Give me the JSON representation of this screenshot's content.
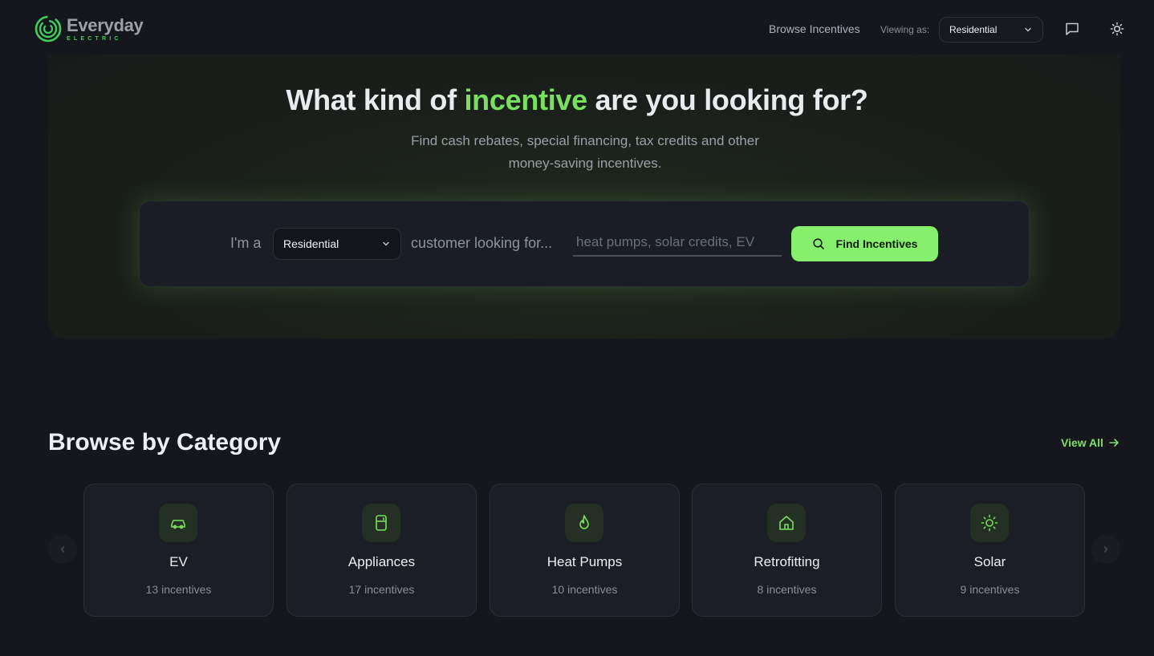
{
  "brand": {
    "name": "Everyday",
    "sub": "ELECTRIC"
  },
  "nav": {
    "browse_link": "Browse Incentives",
    "viewing_label": "Viewing as:",
    "viewing_value": "Residential"
  },
  "hero": {
    "title_before": "What kind of ",
    "title_accent": "incentive",
    "title_after": " are you looking for?",
    "subtitle": "Find cash rebates, special financing, tax credits and other money-saving incentives."
  },
  "search": {
    "prefix": "I'm a",
    "customer_type": "Residential",
    "middle": "customer looking for...",
    "placeholder": "heat pumps, solar credits, EV",
    "button_label": "Find Incentives"
  },
  "browse": {
    "title": "Browse by Category",
    "view_all": "View All",
    "categories": [
      {
        "name": "EV",
        "count": "13 incentives",
        "icon": "car-icon"
      },
      {
        "name": "Appliances",
        "count": "17 incentives",
        "icon": "fridge-icon"
      },
      {
        "name": "Heat Pumps",
        "count": "10 incentives",
        "icon": "flame-icon"
      },
      {
        "name": "Retrofitting",
        "count": "8 incentives",
        "icon": "house-icon"
      },
      {
        "name": "Solar",
        "count": "9 incentives",
        "icon": "sun-icon"
      }
    ]
  },
  "colors": {
    "accent": "#86ef6c",
    "background": "#15171c",
    "card": "#1c1e25"
  }
}
